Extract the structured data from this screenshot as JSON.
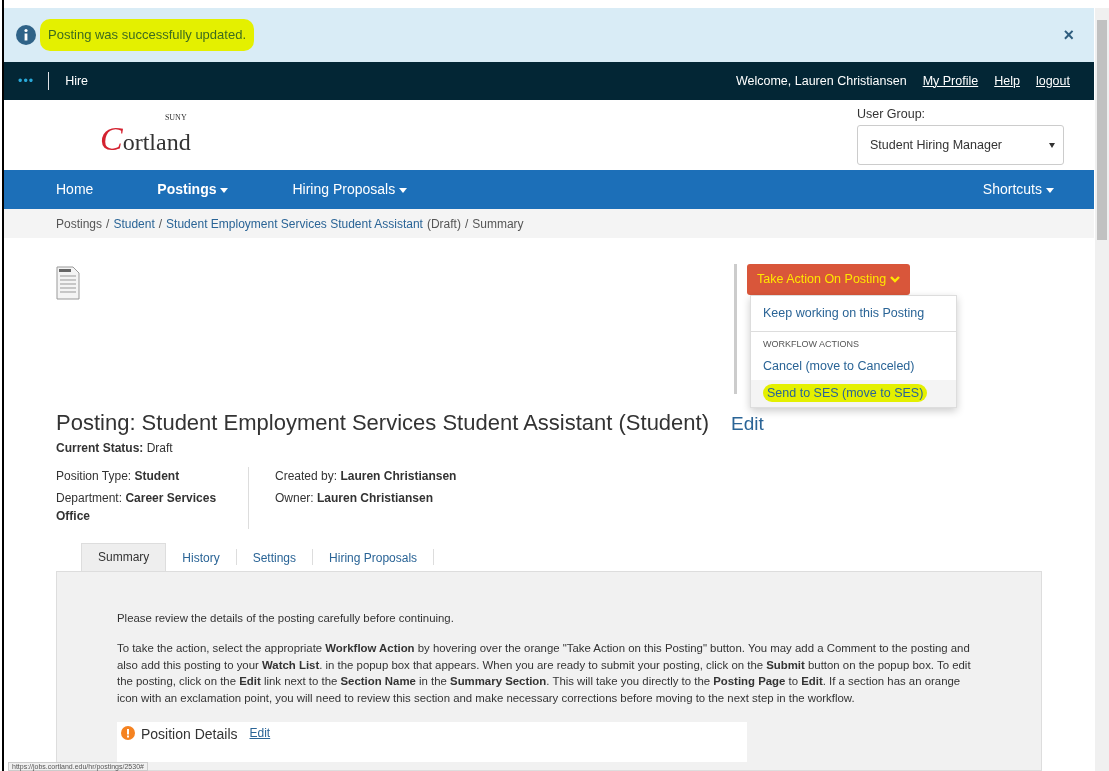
{
  "alert": {
    "message": "Posting was successfully updated.",
    "highlighted": true,
    "close": "×"
  },
  "topbar": {
    "menu": "•••",
    "app": "Hire",
    "welcome": "Welcome, Lauren Christiansen",
    "links": [
      "My Profile",
      "Help",
      "logout"
    ]
  },
  "logo": {
    "small": "SUNY",
    "initial": "C",
    "rest": "ortland"
  },
  "user_group": {
    "label": "User Group:",
    "value": "Student Hiring Manager"
  },
  "nav": [
    {
      "label": "Home",
      "dropdown": false,
      "selected": false
    },
    {
      "label": "Postings",
      "dropdown": true,
      "selected": true
    },
    {
      "label": "Hiring Proposals",
      "dropdown": true,
      "selected": false
    }
  ],
  "shortcuts": {
    "label": "Shortcuts"
  },
  "breadcrumb": [
    {
      "label": "Postings",
      "link": false
    },
    {
      "separator": "/",
      "label": "Student",
      "link": true
    },
    {
      "separator": "/",
      "label": "Student Employment Services Student Assistant",
      "link": true,
      "suffix": "(Draft)"
    },
    {
      "separator": "/",
      "label": "Summary",
      "link": false
    }
  ],
  "action_menu": {
    "button": "Take Action On Posting",
    "items": [
      {
        "kind": "item",
        "label": "Keep working on this Posting",
        "highlighted": false
      },
      {
        "kind": "header",
        "label": "WORKFLOW ACTIONS"
      },
      {
        "kind": "item",
        "label": "Cancel (move to Canceled)",
        "highlighted": false
      },
      {
        "kind": "item",
        "label": "Send to SES (move to SES)",
        "highlighted": true
      }
    ]
  },
  "title": "Posting: Student Employment Services Student Assistant (Student)",
  "title_edit": "Edit",
  "status": {
    "label": "Current Status:",
    "value": "Draft"
  },
  "details_left": [
    {
      "label": "Position Type:",
      "value": "Student"
    },
    {
      "label": "Department:",
      "value": "Career Services Office"
    }
  ],
  "details_right": [
    {
      "label": "Created by:",
      "value": "Lauren Christiansen"
    },
    {
      "label": "Owner:",
      "value": "Lauren Christiansen"
    }
  ],
  "tabs": [
    {
      "label": "Summary",
      "selected": true
    },
    {
      "label": "History",
      "selected": false
    },
    {
      "label": "Settings",
      "selected": false
    },
    {
      "label": "Hiring Proposals",
      "selected": false
    }
  ],
  "paragraphs": [
    "Please review the details of the posting carefully before continuing.",
    "To take the action, select the appropriate **Workflow Action** by hovering over the orange \"Take Action on this Posting\" button. You may add a Comment to the posting and also add this posting to your **Watch List**. in the popup box that appears. When you are ready to submit your posting, click on the **Submit** button on the popup box. To edit the posting, click on the **Edit** link next to the **Section Name** in the **Summary Section**. This will take you directly to the **Posting Page** to **Edit**. If a section has an orange icon with an exclamation point, you will need to review this section and make necessary corrections before moving to the next step in the workflow."
  ],
  "section": {
    "title": "Position Details",
    "edit": "Edit",
    "warning": true
  },
  "status_url": "https://jobs.cortland.edu/hr/postings/2530#"
}
